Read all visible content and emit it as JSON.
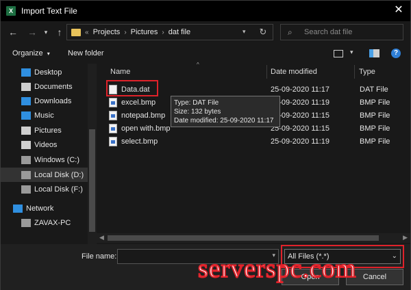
{
  "window": {
    "title": "Import Text File",
    "app_icon_letter": "X"
  },
  "address": {
    "prefix": "«",
    "crumbs": [
      "Projects",
      "Pictures",
      "dat file"
    ]
  },
  "search": {
    "placeholder": "Search dat file"
  },
  "toolbar": {
    "organize_label": "Organize",
    "new_folder_label": "New folder"
  },
  "nav": {
    "items": [
      {
        "label": "Desktop",
        "icon": "desktop-icon",
        "color": "#2f8fe0"
      },
      {
        "label": "Documents",
        "icon": "documents-icon",
        "color": "#cfcfcf"
      },
      {
        "label": "Downloads",
        "icon": "downloads-icon",
        "color": "#2f8fe0"
      },
      {
        "label": "Music",
        "icon": "music-icon",
        "color": "#2f8fe0"
      },
      {
        "label": "Pictures",
        "icon": "pictures-icon",
        "color": "#cfcfcf"
      },
      {
        "label": "Videos",
        "icon": "videos-icon",
        "color": "#cfcfcf"
      },
      {
        "label": "Windows (C:)",
        "icon": "drive-icon",
        "color": "#9a9a9a"
      },
      {
        "label": "Local Disk (D:)",
        "icon": "drive-icon",
        "color": "#9a9a9a"
      },
      {
        "label": "Local Disk (F:)",
        "icon": "drive-icon",
        "color": "#9a9a9a"
      },
      {
        "label": "Network",
        "icon": "network-icon",
        "color": "#2f8fe0"
      },
      {
        "label": "ZAVAX-PC",
        "icon": "computer-icon",
        "color": "#9a9a9a"
      }
    ]
  },
  "columns": {
    "name": "Name",
    "date": "Date modified",
    "type": "Type"
  },
  "files": [
    {
      "name": "Data.dat",
      "date": "25-09-2020 11:17",
      "type": "DAT File",
      "kind": "dat"
    },
    {
      "name": "excel.bmp",
      "date": "25-09-2020 11:19",
      "type": "BMP File",
      "kind": "bmp"
    },
    {
      "name": "notepad.bmp",
      "date": "25-09-2020 11:15",
      "type": "BMP File",
      "kind": "bmp"
    },
    {
      "name": "open with.bmp",
      "date": "25-09-2020 11:15",
      "type": "BMP File",
      "kind": "bmp"
    },
    {
      "name": "select.bmp",
      "date": "25-09-2020 11:19",
      "type": "BMP File",
      "kind": "bmp"
    }
  ],
  "tooltip": {
    "line1": "Type: DAT File",
    "line2": "Size: 132 bytes",
    "line3": "Date modified: 25-09-2020 11:17"
  },
  "bottom": {
    "file_name_label": "File name:",
    "file_name_value": "",
    "filter_value": "All Files (*.*)",
    "open_label": "Open",
    "cancel_label": "Cancel"
  },
  "watermark": {
    "text": "serverspc.com"
  },
  "colors": {
    "highlight": "#e0222a",
    "background": "#191919"
  }
}
